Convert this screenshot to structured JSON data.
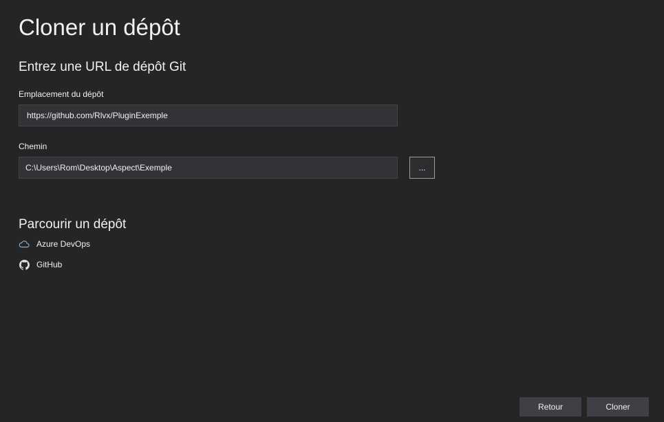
{
  "page": {
    "title": "Cloner un dépôt"
  },
  "clone_section": {
    "title": "Entrez une URL de dépôt Git",
    "repo_location_label": "Emplacement du dépôt",
    "repo_location_value": "https://github.com/Rlvx/PluginExemple",
    "path_label": "Chemin",
    "path_value": "C:\\Users\\Rom\\Desktop\\Aspect\\Exemple",
    "browse_label": "..."
  },
  "browse_section": {
    "title": "Parcourir un dépôt",
    "items": [
      {
        "label": "Azure DevOps",
        "icon": "cloud-icon"
      },
      {
        "label": "GitHub",
        "icon": "github-icon"
      }
    ]
  },
  "footer": {
    "back_label": "Retour",
    "clone_label": "Cloner"
  },
  "colors": {
    "background": "#252526",
    "input_background": "#333337",
    "button_background": "#3f3f46",
    "azure_icon": "#7fb2d4"
  }
}
